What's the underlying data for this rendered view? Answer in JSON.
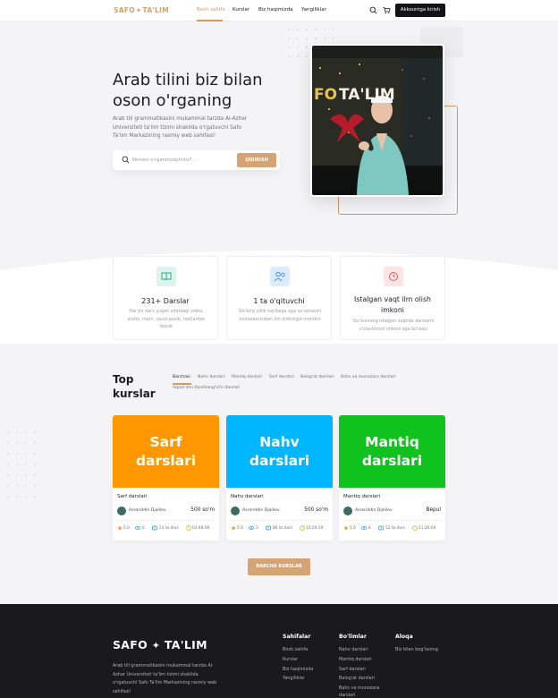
{
  "header": {
    "logo_left": "SAFO",
    "logo_right": "TA'LIM",
    "nav": [
      "Bosh sahifa",
      "Kurslar",
      "Biz haqimizda",
      "Yangiliklar"
    ],
    "login_label": "Akkountga kirish"
  },
  "hero": {
    "title": "Arab tilini biz bilan oson o'rganing",
    "description": "Arab tili grammatikasini mukammal tarzda Al-Azhar Universiteti ta'lim tizimi shaklida o'rgatuvchi Safo Ta'lim Markazining rasmiy web sahifasi!",
    "search_placeholder": "Nimani o'rganmoqchisiz?...",
    "search_button": "QIDIRISH"
  },
  "features": [
    {
      "title": "231+ Darslar",
      "desc": "Har bir dars yuqori sifatdagi video, audio, matn, savol-javob, testlardan iborat",
      "icon": "book-icon"
    },
    {
      "title": "1 ta o'qituvchi",
      "desc": "Siz ko'p yillik tajribaga ega oz sohasini mutaxassisidan ilm olishingiz mumkin",
      "icon": "users-icon"
    },
    {
      "title": "Istalgan vaqt ilm olish imkoni",
      "desc": "Siz kunning istalgan vaqtida darslarni o'zlashtirish imkoni ega bo'lasiz",
      "icon": "clock-icon"
    }
  ],
  "courses_section": {
    "title_line1": "Top",
    "title_line2": "kurslar",
    "tabs": [
      "Barchasi",
      "Nahv darslari",
      "Mantiq darslari",
      "Sarf darslari",
      "Balog'at darslari",
      "Bahs va munozara darslari",
      "Aqaid ilmi (boshlang'ich) darslari"
    ],
    "all_button": "BARCHA KURSLAR"
  },
  "courses": [
    {
      "thumb_line1": "Sarf",
      "thumb_line2": "darslari",
      "color": "#FF9800",
      "name": "Sarf darslari",
      "author": "Asroriddin Djalilov",
      "price": "500 so'm",
      "rating": "5.0",
      "views": "6",
      "lessons": "23 ta dars",
      "duration": "03:48:06"
    },
    {
      "thumb_line1": "Nahv",
      "thumb_line2": "darslari",
      "color": "#00B7FF",
      "name": "Nahv darslari",
      "author": "Asroriddin Djalilov",
      "price": "500 so'm",
      "rating": "5.0",
      "views": "3",
      "lessons": "86 ta dars",
      "duration": "10:29:29"
    },
    {
      "thumb_line1": "Mantiq",
      "thumb_line2": "darslari",
      "color": "#10C21E",
      "name": "Mantiq darslari",
      "author": "Asroriddin Djalilov",
      "price": "Bepul",
      "rating": "5.0",
      "views": "4",
      "lessons": "52 ta dars",
      "duration": "21:26:04"
    }
  ],
  "footer": {
    "logo_left": "SAFO",
    "logo_right": "TA'LIM",
    "about": "Arab tili grammatikasini mukammal tarzda Al-Azhar Universiteti ta'lim tizimi shaklida o'rgatuvchi Safo Ta'lim Markazining rasmiy web sahifasi!",
    "col1_title": "Sahifalar",
    "col1_links": [
      "Bosh sahifa",
      "Kurslar",
      "Biz haqimizda",
      "Yangiliklar"
    ],
    "col2_title": "Bo'limlar",
    "col2_links": [
      "Nahv darslari",
      "Mantiq darslari",
      "Sarf darslari",
      "Balog'at darslari",
      "Bahs va munozara darslari"
    ],
    "col3_title": "Aloqa",
    "col3_links": [
      "Biz bilan bog'laning"
    ]
  },
  "colors": {
    "accent": "#D49A60",
    "button": "#D4A474",
    "dark": "#141418",
    "footer": "#1A1A1C"
  }
}
